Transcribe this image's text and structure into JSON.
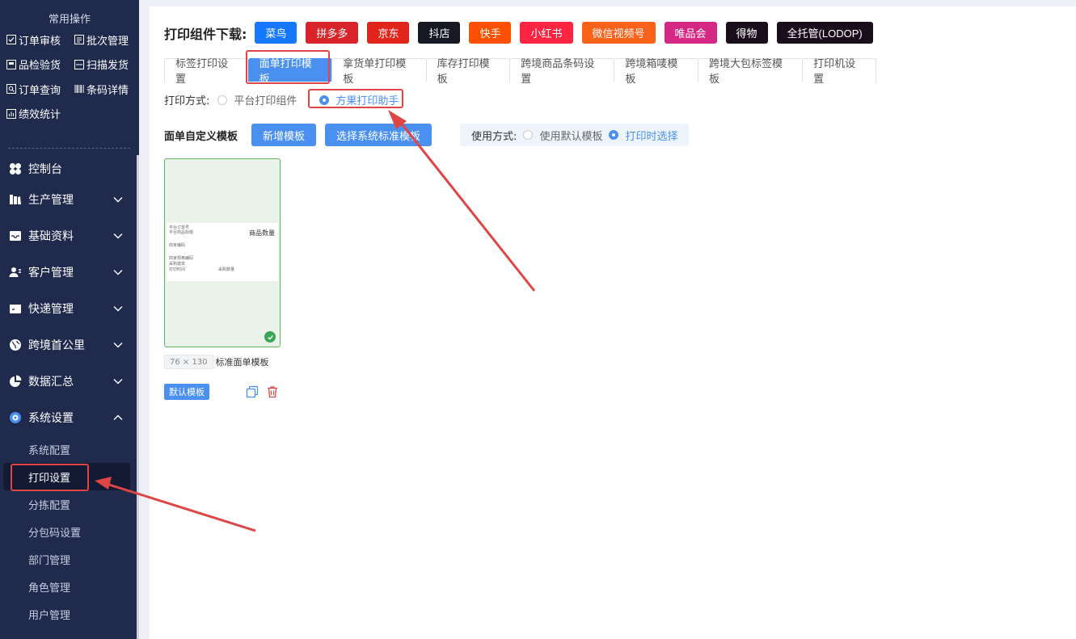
{
  "sidebar": {
    "quick_title": "常用操作",
    "quick_items": [
      {
        "label": "订单审核",
        "icon": "checkbox-icon"
      },
      {
        "label": "批次管理",
        "icon": "batch-icon"
      },
      {
        "label": "品检验货",
        "icon": "inspect-icon"
      },
      {
        "label": "扫描发货",
        "icon": "scan-icon"
      },
      {
        "label": "订单查询",
        "icon": "query-icon"
      },
      {
        "label": "条码详情",
        "icon": "barcode-icon"
      },
      {
        "label": "绩效统计",
        "icon": "stats-icon"
      }
    ],
    "menu": [
      {
        "label": "控制台",
        "icon": "dashboard-icon"
      },
      {
        "label": "生产管理",
        "icon": "production-icon"
      },
      {
        "label": "基础资料",
        "icon": "inbox-icon"
      },
      {
        "label": "客户管理",
        "icon": "customers-icon"
      },
      {
        "label": "快递管理",
        "icon": "express-icon"
      },
      {
        "label": "跨境首公里",
        "icon": "globe-icon"
      },
      {
        "label": "数据汇总",
        "icon": "pie-icon"
      },
      {
        "label": "系统设置",
        "icon": "settings-icon"
      }
    ],
    "system_submenu": [
      "系统配置",
      "打印设置",
      "分拣配置",
      "分包码设置",
      "部门管理",
      "角色管理",
      "用户管理"
    ]
  },
  "download": {
    "title": "打印组件下载:",
    "buttons": [
      {
        "label": "菜鸟",
        "color": "#1677ff"
      },
      {
        "label": "拼多多",
        "color": "#d9232a"
      },
      {
        "label": "京东",
        "color": "#e1251b"
      },
      {
        "label": "抖店",
        "color": "#161823"
      },
      {
        "label": "快手",
        "color": "#ff5000"
      },
      {
        "label": "小红书",
        "color": "#ff2442"
      },
      {
        "label": "微信视频号",
        "color": "#fa6119"
      },
      {
        "label": "唯品会",
        "color": "#d42884"
      },
      {
        "label": "得物",
        "color": "#1a0d1c"
      },
      {
        "label": "全托管(LODOP)",
        "color": "#1a0d1c"
      }
    ]
  },
  "tabs": [
    "标签打印设置",
    "面单打印模板",
    "拿货单打印模板",
    "库存打印模板",
    "跨境商品条码设置",
    "跨境箱唛模板",
    "跨境大包标签模板",
    "打印机设置"
  ],
  "print_mode": {
    "label": "打印方式:",
    "options": [
      "平台打印组件",
      "方果打印助手"
    ]
  },
  "template": {
    "title": "面单自定义模板",
    "add_button": "新增模板",
    "choose_button": "选择系统标准模板",
    "use_label": "使用方式:",
    "use_options": [
      "使用默认模板",
      "打印时选择"
    ]
  },
  "card": {
    "paper_lines": [
      "平台订单号",
      "平台商品标题",
      "商品数量",
      "商家编码",
      "商家规格编码",
      "采购建单",
      "打印时间",
      "采购数量"
    ],
    "size": "76 × 130",
    "name": "标准面单模板",
    "default_button": "默认模板"
  },
  "colors": {
    "sidebar_bg": "#1f2a4d",
    "accent": "#4a90f0",
    "annotation": "#e04545"
  }
}
